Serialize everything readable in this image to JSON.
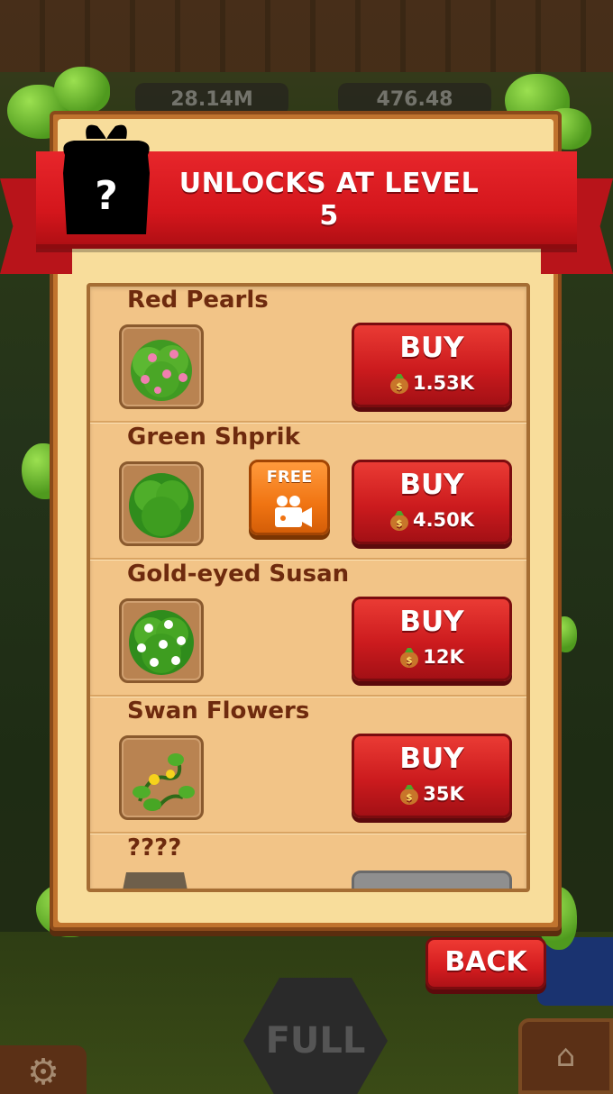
{
  "background": {
    "stat_left": "28.14M",
    "stat_right": "476.48",
    "full_label": "FULL"
  },
  "banner": {
    "title": "UNLOCKS AT LEVEL 5",
    "mystery_symbol": "?"
  },
  "items": [
    {
      "name": "Red Pearls",
      "buy_label": "BUY",
      "price": "1.53K",
      "has_free": false
    },
    {
      "name": "Green Shprik",
      "buy_label": "BUY",
      "price": "4.50K",
      "has_free": true,
      "free_label": "FREE"
    },
    {
      "name": "Gold-eyed Susan",
      "buy_label": "BUY",
      "price": "12K",
      "has_free": false
    },
    {
      "name": "Swan Flowers",
      "buy_label": "BUY",
      "price": "35K",
      "has_free": false
    },
    {
      "name": "????",
      "locked": true
    }
  ],
  "back_button": {
    "label": "BACK"
  },
  "colors": {
    "banner_red": "#d4161c",
    "buy_red": "#cc1b1e",
    "free_orange": "#f07412",
    "panel_tan": "#f2c487",
    "name_brown": "#6e2a0e"
  }
}
